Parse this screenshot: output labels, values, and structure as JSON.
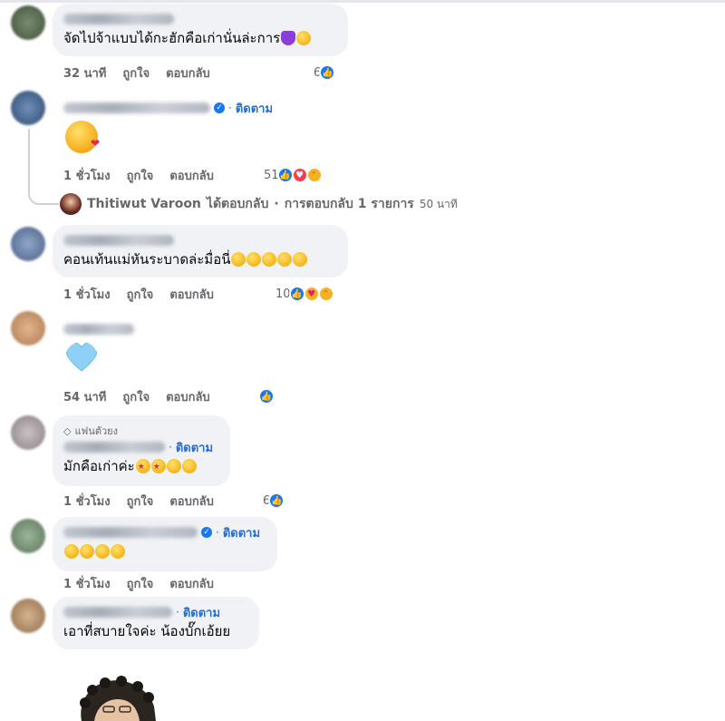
{
  "comments": [
    {
      "text": "จัดไปจ้าแบบได้กะฮักคือเก่านั่นล่ะการ",
      "actions": {
        "time": "32 นาที",
        "like": "ถูกใจ",
        "reply": "ตอบกลับ"
      },
      "reaction_count": "6"
    },
    {
      "follow": "ติดตาม",
      "big_emoji": "kiss-face",
      "actions": {
        "time": "1 ชั่วโมง",
        "like": "ถูกใจ",
        "reply": "ตอบกลับ"
      },
      "reaction_count": "51",
      "reply_summary": {
        "name": "Thitiwut Varoon",
        "replied": "ได้ตอบกลับ",
        "sep": "·",
        "count_text": "การตอบกลับ 1 รายการ",
        "time": "50 นาที"
      }
    },
    {
      "text": "คอนเท้นแม่หันระบาดล่ะมื่อนี่",
      "actions": {
        "time": "1 ชั่วโมง",
        "like": "ถูกใจ",
        "reply": "ตอบกลับ"
      },
      "reaction_count": "10"
    },
    {
      "big_emoji": "light-blue-heart",
      "actions": {
        "time": "54 นาที",
        "like": "ถูกใจ",
        "reply": "ตอบกลับ"
      }
    },
    {
      "badge": "แฟนตัวยง",
      "follow": "ติดตาม",
      "text": "มักคือเก่าค่ะ",
      "actions": {
        "time": "1 ชั่วโมง",
        "like": "ถูกใจ",
        "reply": "ตอบกลับ"
      },
      "reaction_count": "6"
    },
    {
      "follow": "ติดตาม",
      "actions": {
        "time": "1 ชั่วโมง",
        "like": "ถูกใจ",
        "reply": "ตอบกลับ"
      }
    },
    {
      "follow": "ติดตาม",
      "text": "เอาที่สบายใจค่ะ น้องบั๊กเอ้ยย"
    }
  ],
  "colors": {
    "bubble": "#f0f2f5",
    "link_blue": "#216fdb",
    "meta_gray": "#65676b",
    "like_blue": "#1877f2"
  }
}
